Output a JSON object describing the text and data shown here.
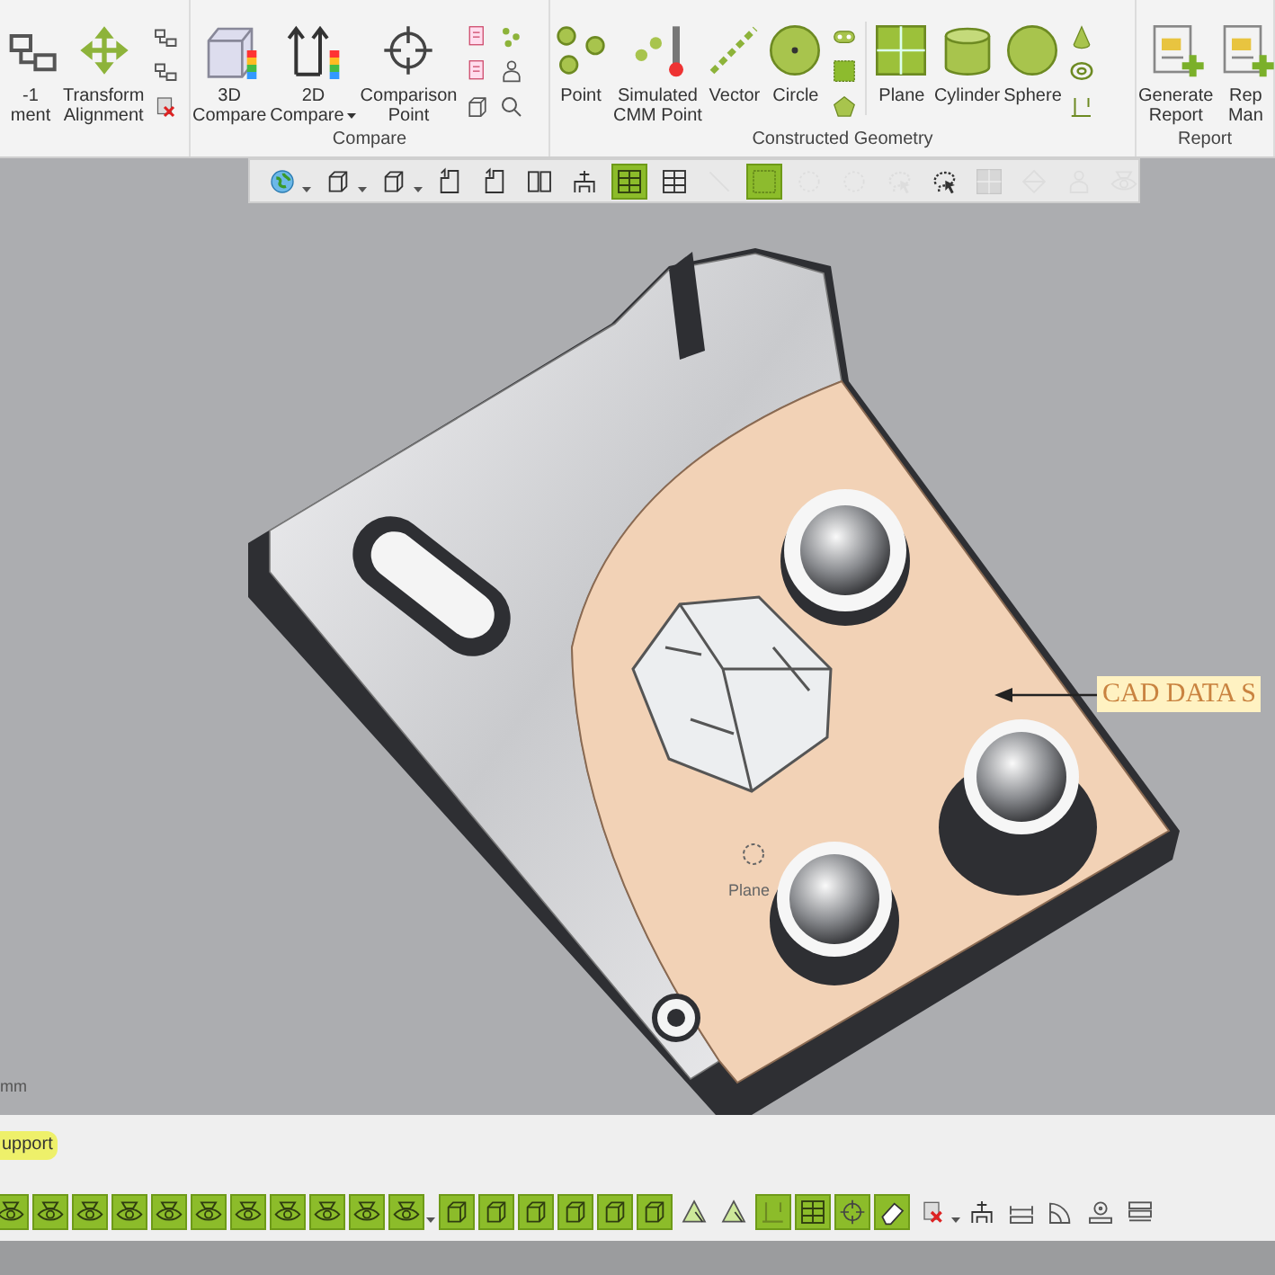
{
  "ribbon": {
    "groups": [
      {
        "items": [
          {
            "lines": [
              "-1",
              "ment"
            ],
            "kind": "align"
          },
          {
            "lines": [
              "Transform",
              "Alignment"
            ],
            "kind": "move"
          }
        ],
        "small_tools": [
          {
            "kind": "align"
          },
          {
            "kind": "align"
          },
          {
            "kind": "delete"
          }
        ]
      },
      {
        "label": "Compare",
        "items": [
          {
            "lines": [
              "3D",
              "Compare"
            ],
            "kind": "cube-color",
            "dropdown": false
          },
          {
            "lines": [
              "2D",
              "Compare"
            ],
            "kind": "arrows-color",
            "dropdown": true
          },
          {
            "lines": [
              "Comparison",
              "Point"
            ],
            "kind": "crosshair",
            "dropdown": false
          }
        ],
        "small_tools": [
          {
            "kind": "doc"
          },
          {
            "kind": "doc"
          },
          {
            "kind": "cube"
          },
          {
            "kind": "dots"
          },
          {
            "kind": "person"
          },
          {
            "kind": "search"
          }
        ]
      },
      {
        "label": "Constructed Geometry",
        "items": [
          {
            "lines": [
              "Point"
            ],
            "kind": "points"
          },
          {
            "lines": [
              "Simulated",
              "CMM Point"
            ],
            "kind": "cmm"
          },
          {
            "lines": [
              "Vector"
            ],
            "kind": "vector"
          },
          {
            "lines": [
              "Circle"
            ],
            "kind": "circle"
          }
        ],
        "small_tools": [
          {
            "kind": "slot"
          },
          {
            "kind": "square"
          },
          {
            "kind": "pentagon"
          }
        ],
        "items_2": [
          {
            "lines": [
              "Plane"
            ],
            "kind": "plane"
          },
          {
            "lines": [
              "Cylinder"
            ],
            "kind": "cylinder"
          },
          {
            "lines": [
              "Sphere"
            ],
            "kind": "sphere"
          }
        ],
        "small_tools_2": [
          {
            "kind": "cone"
          },
          {
            "kind": "torus"
          },
          {
            "kind": "axes"
          }
        ]
      },
      {
        "label": "Report",
        "items": [
          {
            "lines": [
              "Generate",
              "Report"
            ],
            "kind": "report"
          },
          {
            "lines": [
              "Rep",
              "Man"
            ],
            "kind": "report"
          }
        ]
      }
    ]
  },
  "view_toolbar": [
    {
      "kind": "globe",
      "on": false,
      "disabled": false,
      "dropdown": true
    },
    {
      "kind": "cube",
      "on": false,
      "disabled": false,
      "dropdown": true
    },
    {
      "kind": "cube",
      "on": false,
      "disabled": false,
      "dropdown": true
    },
    {
      "kind": "view",
      "on": false,
      "disabled": false,
      "dropdown": false
    },
    {
      "kind": "view",
      "on": false,
      "disabled": false,
      "dropdown": false
    },
    {
      "kind": "split",
      "on": false,
      "disabled": false,
      "dropdown": false
    },
    {
      "kind": "fixture",
      "on": false,
      "disabled": false,
      "dropdown": false
    },
    {
      "kind": "grid",
      "on": true,
      "disabled": false,
      "dropdown": false
    },
    {
      "kind": "grid",
      "on": false,
      "disabled": false,
      "dropdown": false
    },
    {
      "kind": "line",
      "on": false,
      "disabled": true,
      "dropdown": false
    },
    {
      "kind": "square",
      "on": true,
      "disabled": false,
      "dropdown": false
    },
    {
      "kind": "dashed-circle",
      "on": false,
      "disabled": true,
      "dropdown": false
    },
    {
      "kind": "dashed-circle",
      "on": false,
      "disabled": true,
      "dropdown": false
    },
    {
      "kind": "lasso",
      "on": false,
      "disabled": true,
      "dropdown": false
    },
    {
      "kind": "lasso",
      "on": false,
      "disabled": false,
      "dropdown": false
    },
    {
      "kind": "plane",
      "on": false,
      "disabled": true,
      "dropdown": false
    },
    {
      "kind": "diamond",
      "on": false,
      "disabled": true,
      "dropdown": false
    },
    {
      "kind": "person",
      "on": false,
      "disabled": true,
      "dropdown": false
    },
    {
      "kind": "eye",
      "on": false,
      "disabled": true,
      "dropdown": false
    }
  ],
  "viewport": {
    "callout": "CAD DATA S",
    "feature_label": "Plane",
    "units": "mm"
  },
  "panel_tab": {
    "label": "upport"
  },
  "bottom_toolbar": [
    {
      "kind": "eye",
      "on": true,
      "dropdown": false
    },
    {
      "kind": "eye",
      "on": true,
      "dropdown": false
    },
    {
      "kind": "eye",
      "on": true,
      "dropdown": false
    },
    {
      "kind": "eye",
      "on": true,
      "dropdown": false
    },
    {
      "kind": "eye",
      "on": true,
      "dropdown": false
    },
    {
      "kind": "eye",
      "on": true,
      "dropdown": false
    },
    {
      "kind": "eye",
      "on": true,
      "dropdown": false
    },
    {
      "kind": "eye",
      "on": true,
      "dropdown": false
    },
    {
      "kind": "eye",
      "on": true,
      "dropdown": false
    },
    {
      "kind": "eye",
      "on": true,
      "dropdown": false
    },
    {
      "kind": "eye",
      "on": true,
      "dropdown": true
    },
    {
      "kind": "cube",
      "on": true,
      "dropdown": false
    },
    {
      "kind": "cube",
      "on": true,
      "dropdown": false
    },
    {
      "kind": "cube",
      "on": true,
      "dropdown": false
    },
    {
      "kind": "cube",
      "on": true,
      "dropdown": false
    },
    {
      "kind": "cube",
      "on": true,
      "dropdown": false
    },
    {
      "kind": "cube",
      "on": true,
      "dropdown": false
    },
    {
      "kind": "triangle",
      "on": false,
      "dropdown": false
    },
    {
      "kind": "triangle",
      "on": false,
      "dropdown": false
    },
    {
      "kind": "axes",
      "on": true,
      "dropdown": false
    },
    {
      "kind": "grid",
      "on": true,
      "dropdown": false
    },
    {
      "kind": "crosshair",
      "on": true,
      "dropdown": false
    },
    {
      "kind": "eraser",
      "on": true,
      "dropdown": false
    },
    {
      "kind": "delete",
      "on": false,
      "dropdown": true
    },
    {
      "kind": "fixture",
      "on": false,
      "dropdown": false
    },
    {
      "kind": "ruler",
      "on": false,
      "dropdown": false
    },
    {
      "kind": "arc",
      "on": false,
      "dropdown": false
    },
    {
      "kind": "gauge",
      "on": false,
      "dropdown": false
    },
    {
      "kind": "stack",
      "on": false,
      "dropdown": false
    }
  ]
}
